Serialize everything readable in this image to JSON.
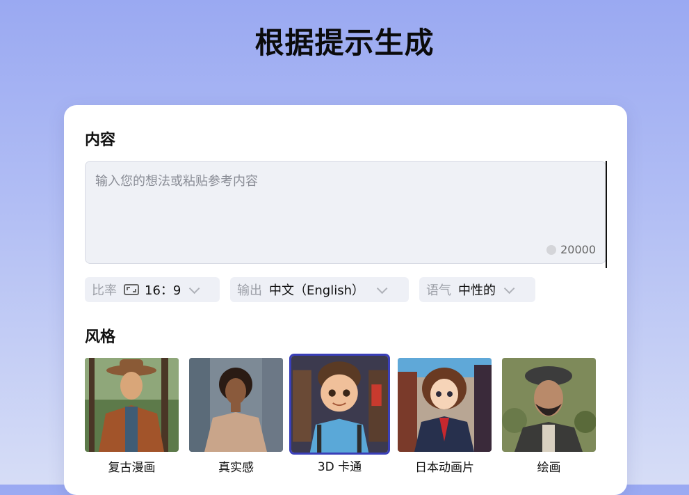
{
  "page": {
    "title": "根据提示生成"
  },
  "content": {
    "label": "内容",
    "placeholder": "输入您的想法或粘贴参考内容",
    "char_limit": "20000"
  },
  "options": {
    "ratio": {
      "key": "比率",
      "value": "16：9"
    },
    "output": {
      "key": "输出",
      "value": "中文（English）"
    },
    "tone": {
      "key": "语气",
      "value": "中性的"
    }
  },
  "style": {
    "label": "风格",
    "selected": "3D 卡通",
    "items": [
      {
        "label": "复古漫画"
      },
      {
        "label": "真实感"
      },
      {
        "label": "3D 卡通"
      },
      {
        "label": "日本动画片"
      },
      {
        "label": "绘画"
      }
    ]
  }
}
